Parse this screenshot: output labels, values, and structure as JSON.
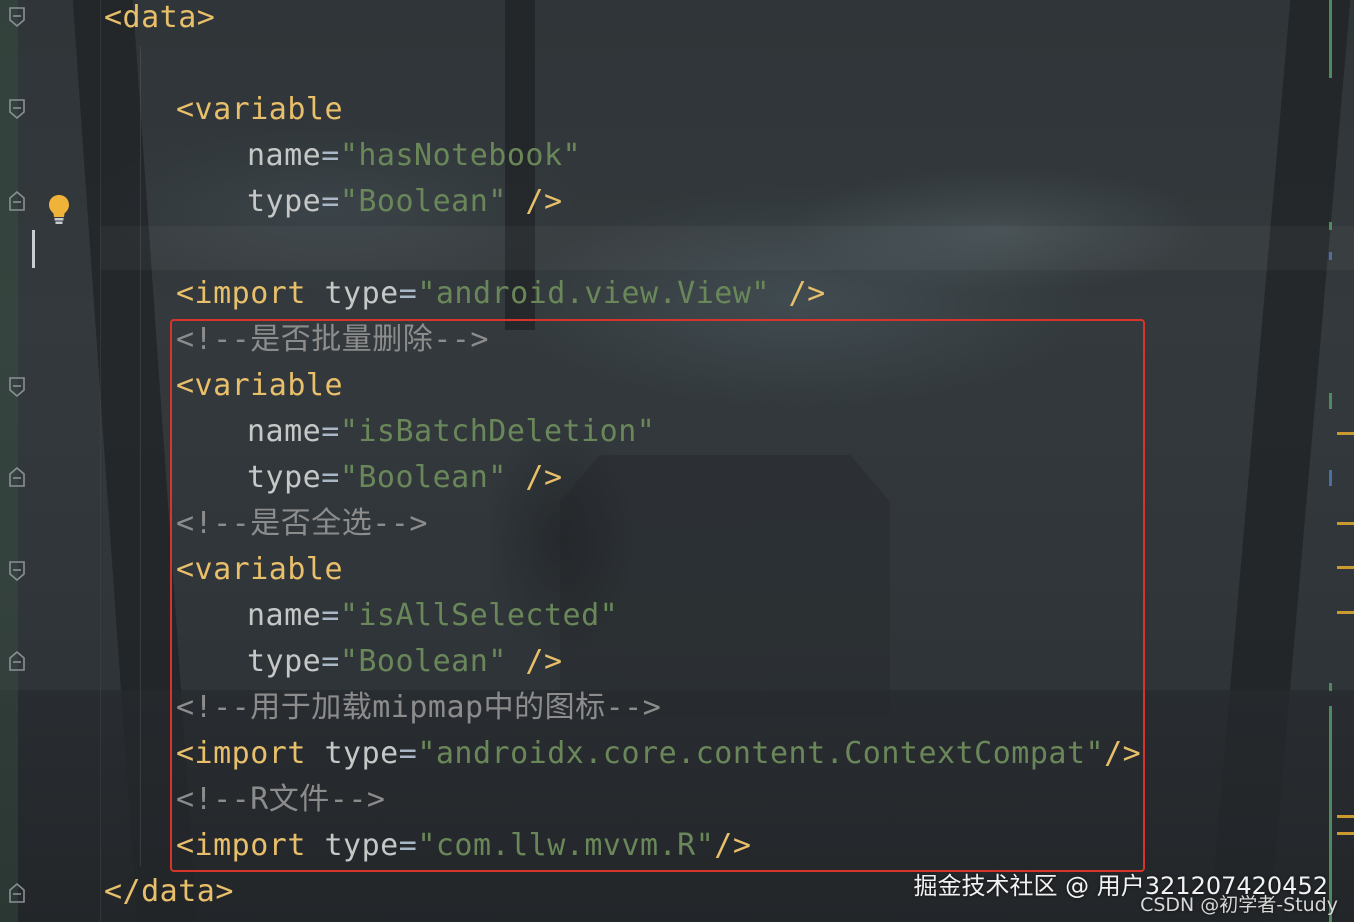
{
  "editor": {
    "lines": [
      {
        "text": "<data>",
        "kind": "tag-open"
      },
      {
        "text": "<variable",
        "kind": "tag"
      },
      {
        "attr": "name",
        "value": "\"hasNotebook\""
      },
      {
        "attr": "type",
        "value": "\"Boolean\"",
        "close": " />"
      },
      {
        "tag": "<import",
        "attr": "type",
        "value": "\"android.view.View\"",
        "close": " />"
      },
      {
        "comment": "<!--是否批量删除-->"
      },
      {
        "text": "<variable",
        "kind": "tag"
      },
      {
        "attr": "name",
        "value": "\"isBatchDeletion\""
      },
      {
        "attr": "type",
        "value": "\"Boolean\"",
        "close": " />"
      },
      {
        "comment": "<!--是否全选-->"
      },
      {
        "text": "<variable",
        "kind": "tag"
      },
      {
        "attr": "name",
        "value": "\"isAllSelected\""
      },
      {
        "attr": "type",
        "value": "\"Boolean\"",
        "close": " />"
      },
      {
        "comment": "<!--用于加载mipmap中的图标-->"
      },
      {
        "tag": "<import",
        "attr": "type",
        "value": "\"androidx.core.content.ContextCompat\"",
        "close": "/>"
      },
      {
        "comment": "<!--R文件-->"
      },
      {
        "tag": "<import",
        "attr": "type",
        "value": "\"com.llw.mvvm.R\"",
        "close": "/>"
      },
      {
        "text": "</data>",
        "kind": "tag-close"
      }
    ]
  },
  "watermark": {
    "main": "掘金技术社区 @ 用户321207420452",
    "sub": "CSDN @初学者-Study"
  },
  "icons": {
    "bulb": "lightbulb-icon",
    "fold": "fold-marker-icon"
  },
  "colors": {
    "tag": "#e8bf6a",
    "string": "#6a8759",
    "comment": "#8c8c8c",
    "highlight_box": "#d8352a"
  }
}
